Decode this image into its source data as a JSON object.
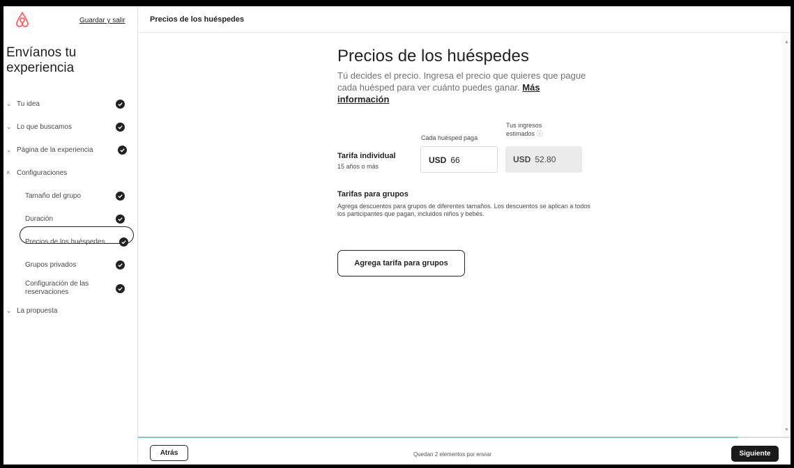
{
  "sidebar": {
    "save_exit": "Guardar y salir",
    "title": "Envíanos tu experiencia",
    "items": [
      {
        "label": "Tu idea",
        "done": true
      },
      {
        "label": "Lo que buscamos",
        "done": true
      },
      {
        "label": "Página de la experiencia",
        "done": true
      },
      {
        "label": "Configuraciones",
        "done": false
      },
      {
        "label": "Tamaño del grupo",
        "done": true
      },
      {
        "label": "Duración",
        "done": true
      },
      {
        "label": "Precios de los huéspedes",
        "done": true
      },
      {
        "label": "Grupos privados",
        "done": true
      },
      {
        "label": "Configuración de las reservaciones",
        "done": true
      },
      {
        "label": "La propuesta",
        "done": false
      }
    ]
  },
  "header": {
    "crumb": "Precios de los huéspedes"
  },
  "main": {
    "title": "Precios de los huéspedes",
    "description": "Tú decides el precio. Ingresa el precio que quieres que pague cada huésped para ver cuánto puedes ganar.",
    "more_link": "Más información",
    "col_price": "Cada huésped paga",
    "col_earn": "Tus ingresos estimados",
    "rate_label": "Tarifa individual",
    "rate_sub": "15 años o más",
    "currency": "USD",
    "price_value": "66",
    "earn_value": "52.80",
    "groups_title": "Tarifas para grupos",
    "groups_desc": "Agrega descuentos para grupos de diferentes tamaños. Los descuentos se aplican a todos los participantes que pagan, incluidos niños y bebés.",
    "add_group_button": "Agrega tarifa para grupos"
  },
  "footer": {
    "back": "Atrás",
    "remaining": "Quedan 2 elementos por enviar",
    "next": "Siguiente",
    "progress": 0.92
  },
  "colors": {
    "brand": "#FF5A5F",
    "progress": "#7fc7c0",
    "primary_button": "#1a1a1a"
  }
}
